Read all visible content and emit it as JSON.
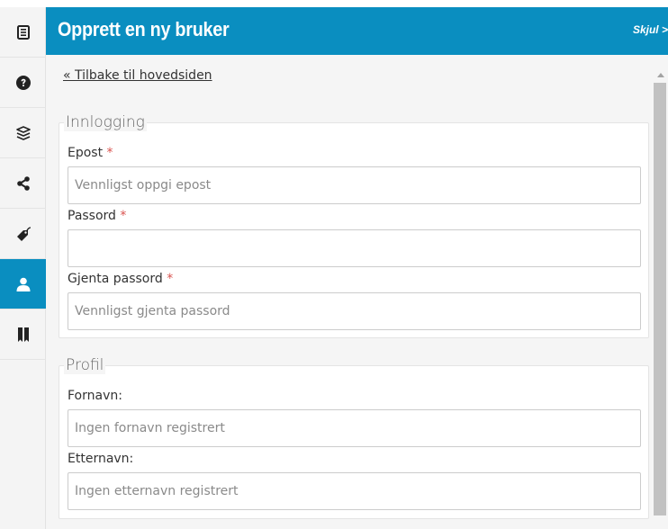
{
  "header": {
    "title": "Opprett en ny bruker",
    "hide_label": "Skjul >"
  },
  "back_link": "« Tilbake til hovedsiden",
  "login": {
    "legend": "Innlogging",
    "email": {
      "label": "Epost",
      "required": "*",
      "placeholder": "Vennligst oppgi epost",
      "value": ""
    },
    "password": {
      "label": "Passord",
      "required": "*",
      "placeholder": "",
      "value": ""
    },
    "repeat_password": {
      "label": "Gjenta passord",
      "required": "*",
      "placeholder": "Vennligst gjenta passord",
      "value": ""
    }
  },
  "profile": {
    "legend": "Profil",
    "first_name": {
      "label": "Fornavn:",
      "placeholder": "Ingen fornavn registrert",
      "value": ""
    },
    "last_name": {
      "label": "Etternavn:",
      "placeholder": "Ingen etternavn registrert",
      "value": ""
    }
  },
  "sidebar": {
    "items": [
      {
        "icon": "document-icon",
        "active": false
      },
      {
        "icon": "help-icon",
        "active": false
      },
      {
        "icon": "layers-icon",
        "active": false
      },
      {
        "icon": "share-icon",
        "active": false
      },
      {
        "icon": "tag-icon",
        "active": false
      },
      {
        "icon": "user-icon",
        "active": true
      },
      {
        "icon": "bookmarks-icon",
        "active": false
      }
    ]
  },
  "colors": {
    "accent": "#0a8ec0",
    "required": "#d9534f"
  }
}
